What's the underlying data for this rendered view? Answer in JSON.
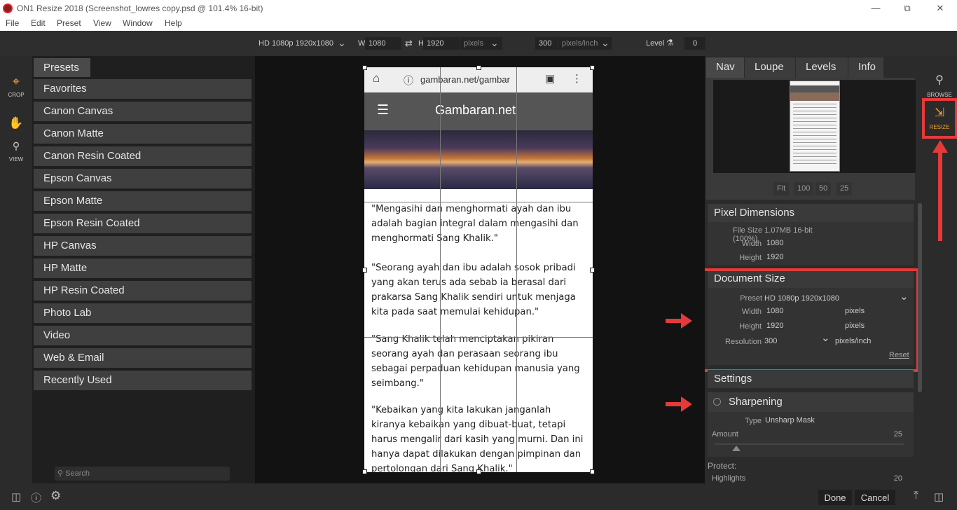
{
  "window": {
    "title": "ON1 Resize 2018 (Screenshot_lowres copy.psd @ 101.4% 16-bit)"
  },
  "menu": [
    "File",
    "Edit",
    "Preset",
    "View",
    "Window",
    "Help"
  ],
  "toolbar": {
    "preset": "HD 1080p 1920x1080",
    "w_label": "W",
    "w_value": "1080",
    "h_label": "H",
    "h_value": "1920",
    "unit": "pixels",
    "resolution": "300",
    "res_unit": "pixels/inch",
    "level_label": "Level",
    "level_value": "0"
  },
  "leftrail": {
    "crop": "CROP",
    "view": "VIEW"
  },
  "presets": {
    "header": "Presets",
    "items": [
      "Favorites",
      "Canon Canvas",
      "Canon Matte",
      "Canon Resin Coated",
      "Epson Canvas",
      "Epson Matte",
      "Epson Resin Coated",
      "HP Canvas",
      "HP Matte",
      "HP Resin Coated",
      "Photo Lab",
      "Video",
      "Web & Email",
      "Recently Used"
    ],
    "search_placeholder": "Search"
  },
  "document": {
    "url": "gambaran.net/gambar",
    "site_title": "Gambaran.net",
    "paragraphs": [
      "\"Mengasihi dan menghormati ayah dan ibu adalah bagian integral dalam mengasihi dan menghormati Sang Khalik.\"",
      "\"Seorang ayah dan ibu adalah sosok pribadi yang akan terus ada sebab ia berasal dari prakarsa Sang Khalik sendiri untuk menjaga kita pada saat memulai kehidupan.\"",
      "\"Sang Khalik telah menciptakan pikiran seorang ayah dan perasaan seorang ibu sebagai perpaduan kehidupan manusia yang seimbang.\"",
      "\"Kebaikan yang kita lakukan janganlah kiranya kebaikan yang dibuat-buat, tetapi harus mengalir dari kasih yang murni. Dan ini hanya dapat dilakukan dengan pimpinan dan pertolongan dari Sang Khalik.\""
    ]
  },
  "rightpanel": {
    "tabs": [
      "Nav",
      "Loupe",
      "Levels",
      "Info"
    ],
    "zoom": [
      "Fit",
      "100",
      "50",
      "25"
    ],
    "pixel_dimensions": {
      "title": "Pixel Dimensions",
      "file_size": "File Size 1.07MB 16-bit (100%)",
      "width_label": "Width",
      "width": "1080",
      "height_label": "Height",
      "height": "1920"
    },
    "document_size": {
      "title": "Document Size",
      "preset_label": "Preset",
      "preset": "HD 1080p 1920x1080",
      "width_label": "Width",
      "width": "1080",
      "width_unit": "pixels",
      "height_label": "Height",
      "height": "1920",
      "height_unit": "pixels",
      "resolution_label": "Resolution",
      "resolution": "300",
      "res_unit": "pixels/inch",
      "reset": "Reset"
    },
    "settings": "Settings",
    "sharpening": {
      "title": "Sharpening",
      "type_label": "Type",
      "type": "Unsharp Mask",
      "amount_label": "Amount",
      "amount": "25",
      "protect": "Protect:",
      "highlights_label": "Highlights",
      "highlights": "20"
    }
  },
  "rightrail": {
    "browse": "BROWSE",
    "resize": "RESIZE"
  },
  "bottom": {
    "done": "Done",
    "cancel": "Cancel"
  },
  "colors": {
    "accent": "#f0a030",
    "annotation": "#e53a3a"
  }
}
